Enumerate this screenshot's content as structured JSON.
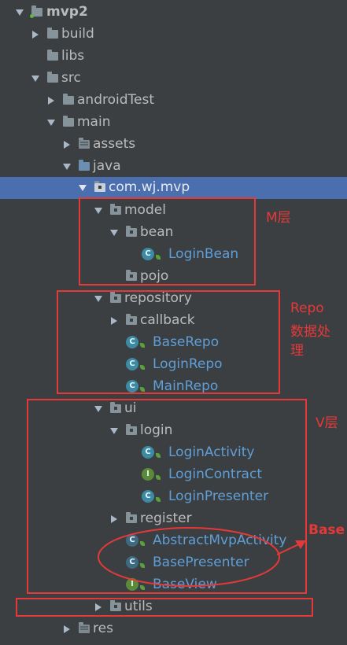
{
  "tree": {
    "project": "mvp2",
    "build": "build",
    "libs": "libs",
    "src": "src",
    "androidTest": "androidTest",
    "main": "main",
    "assets": "assets",
    "java": "java",
    "package": "com.wj.mvp",
    "model": "model",
    "bean": "bean",
    "login_bean": "LoginBean",
    "pojo": "pojo",
    "repository": "repository",
    "callback": "callback",
    "base_repo": "BaseRepo",
    "login_repo": "LoginRepo",
    "main_repo": "MainRepo",
    "ui": "ui",
    "login": "login",
    "login_activity": "LoginActivity",
    "login_contract": "LoginContract",
    "login_presenter": "LoginPresenter",
    "register": "register",
    "abstract_mvp_activity": "AbstractMvpActivity",
    "base_presenter": "BasePresenter",
    "base_view": "BaseView",
    "utils": "utils",
    "res": "res"
  },
  "icons": {
    "class_letter": "C",
    "interface_letter": "I"
  },
  "annotations": {
    "m_layer": "M层",
    "repo": "Repo",
    "repo_desc_1": "数据处",
    "repo_desc_2": "理",
    "v_layer": "V层",
    "base": "Base"
  },
  "colors": {
    "background": "#3c3f41",
    "selection": "#4b6eaf",
    "text": "#bbbbbb",
    "class_text": "#5f9ed6",
    "annotation": "#e53939"
  }
}
